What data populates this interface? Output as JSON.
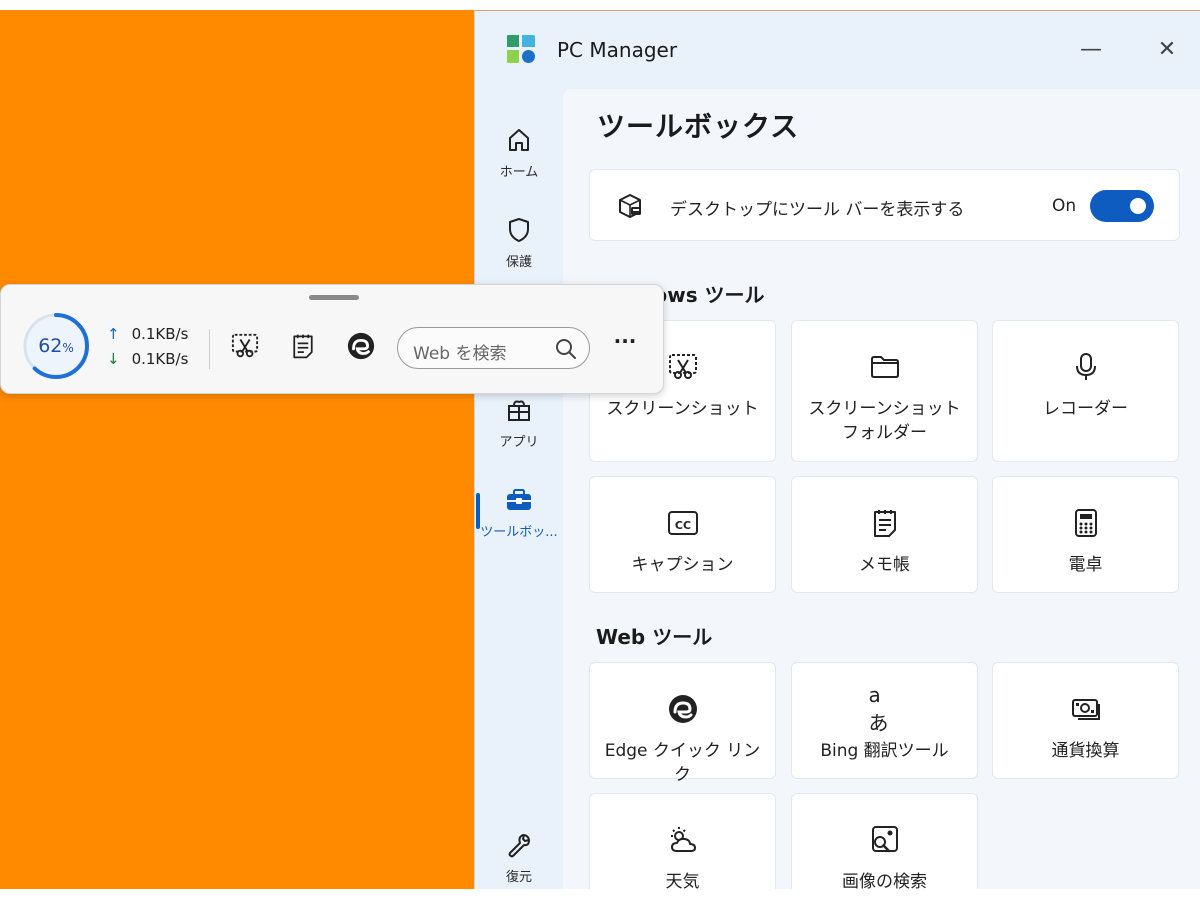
{
  "window": {
    "title": "PC Manager",
    "minimize_glyph": "—",
    "close_glyph": "✕"
  },
  "nav": {
    "items": [
      {
        "label": "ホーム",
        "icon": "home-icon"
      },
      {
        "label": "保護",
        "icon": "shield-icon"
      },
      {
        "label": "",
        "icon": "pie-chart-icon"
      },
      {
        "label": "アプリ",
        "icon": "apps-icon"
      },
      {
        "label": "ツールボッ...",
        "icon": "toolbox-icon",
        "active": true
      },
      {
        "label": "復元",
        "icon": "wrench-icon"
      }
    ]
  },
  "page": {
    "title": "ツールボックス"
  },
  "toggle": {
    "label": "デスクトップにツール バーを表示する",
    "state_text": "On",
    "on": true
  },
  "windows_tools": {
    "title": "Windows ツール",
    "items": [
      {
        "label": "スクリーンショット",
        "icon": "screenshot-icon"
      },
      {
        "label": "スクリーンショット フォルダー",
        "icon": "folder-icon"
      },
      {
        "label": "レコーダー",
        "icon": "microphone-icon"
      },
      {
        "label": "キャプション",
        "icon": "caption-icon"
      },
      {
        "label": "メモ帳",
        "icon": "notepad-icon"
      },
      {
        "label": "電卓",
        "icon": "calculator-icon"
      }
    ]
  },
  "web_tools": {
    "title": "Web ツール",
    "items": [
      {
        "label": "Edge クイック リンク",
        "icon": "edge-icon"
      },
      {
        "label": "Bing 翻訳ツール",
        "icon": "translate-icon",
        "glyph": "aあ"
      },
      {
        "label": "通貨換算",
        "icon": "currency-icon"
      },
      {
        "label": "天気",
        "icon": "weather-icon"
      },
      {
        "label": "画像の検索",
        "icon": "image-search-icon"
      }
    ]
  },
  "floating_toolbar": {
    "memory_percent": 62,
    "memory_value": "62",
    "memory_unit": "%",
    "upload": "0.1KB/s",
    "download": "0.1KB/s",
    "search_placeholder": "Web を検索",
    "more_label": "···"
  },
  "colors": {
    "accent": "#0f5cc0",
    "desktop": "#ff8a00",
    "window_bg": "#e9f1fa",
    "content_bg": "#f3f7fc"
  }
}
